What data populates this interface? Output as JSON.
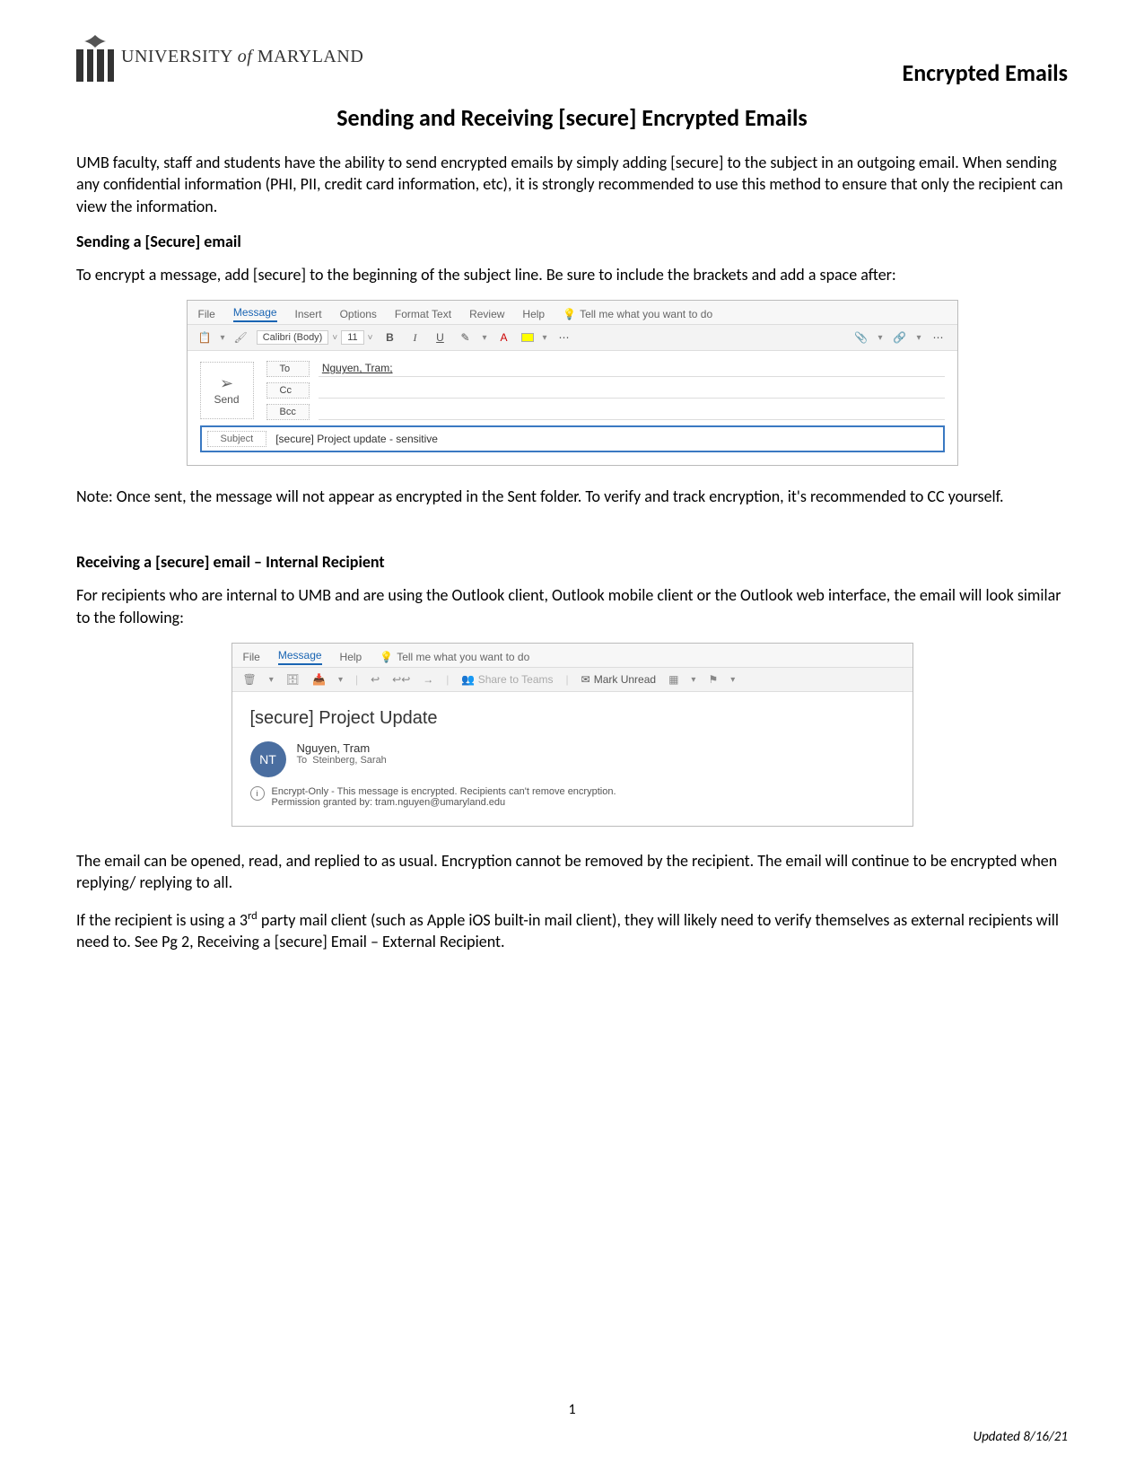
{
  "header": {
    "org_name_html": "UNIVERSITY of MARYLAND",
    "right_title": "Encrypted Emails"
  },
  "title": "Sending and Receiving [secure] Encrypted Emails",
  "intro": "UMB faculty, staff and students have the ability to send encrypted emails by simply adding [secure] to the subject in an outgoing email. When sending any confidential information (PHI, PII, credit card information, etc), it is strongly recommended to use this method to ensure that only the recipient can view the information.",
  "section_sending_heading": "Sending a [Secure] email",
  "sending_instructions": "To encrypt a message, add [secure] to the beginning of the subject line.  Be sure to include the brackets and add a space after:",
  "compose": {
    "tabs": {
      "file": "File",
      "message": "Message",
      "insert": "Insert",
      "options": "Options",
      "format_text": "Format Text",
      "review": "Review",
      "help": "Help",
      "tell_me": "Tell me what you want to do"
    },
    "font_name": "Calibri (Body)",
    "font_size": "11",
    "bold": "B",
    "italic": "I",
    "underline": "U",
    "send_label": "Send",
    "to_label": "To",
    "cc_label": "Cc",
    "bcc_label": "Bcc",
    "to_value": "Nguyen, Tram;",
    "subject_label": "Subject",
    "subject_value": "[secure] Project update - sensitive"
  },
  "note_after_compose": "Note: Once sent, the message will not appear as encrypted in the Sent folder.  To verify and track encryption, it's recommended to CC yourself.",
  "section_receiving_heading": "Receiving a [secure] email – Internal Recipient",
  "receiving_intro": "For recipients who are internal to UMB and are using the Outlook client, Outlook mobile client or the Outlook web interface, the email will look similar to the following:",
  "read": {
    "tabs": {
      "file": "File",
      "message": "Message",
      "help": "Help",
      "tell_me": "Tell me what you want to do"
    },
    "share_teams": "Share to Teams",
    "mark_unread": "Mark Unread",
    "subject": "[secure] Project Update",
    "avatar_initials": "NT",
    "sender_name": "Nguyen, Tram",
    "to_prefix": "To",
    "to_value": "Steinberg, Sarah",
    "encrypt_line1": "Encrypt-Only - This message is encrypted. Recipients can't remove encryption.",
    "encrypt_line2": "Permission granted by: tram.nguyen@umaryland.edu"
  },
  "after_read_p1": "The email can be opened, read, and replied to as usual.  Encryption cannot be removed by the recipient.  The email will continue to be encrypted when replying/ replying to all.",
  "after_read_p2_pre": "If the recipient is using a 3",
  "after_read_p2_sup": "rd",
  "after_read_p2_post": " party mail client (such as Apple iOS built-in mail client), they will likely need to verify themselves as external recipients will need to.  See Pg 2, Receiving a [secure] Email – External Recipient.",
  "page_number": "1",
  "updated": "Updated 8/16/21"
}
